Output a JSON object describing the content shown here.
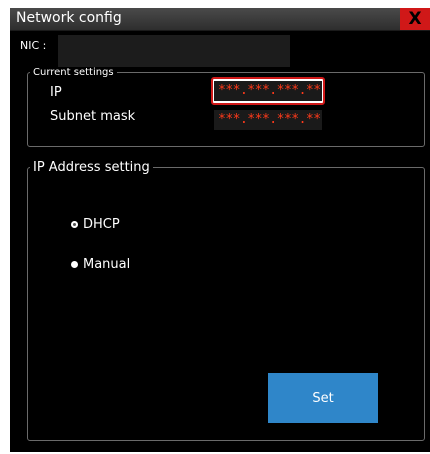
{
  "window": {
    "title": "Network config",
    "close_glyph": "X"
  },
  "nic": {
    "label": "NIC :",
    "value": ""
  },
  "current_settings": {
    "legend": "Current settings",
    "ip_label": "IP",
    "ip_value": "***.***.***.**",
    "subnet_label": "Subnet mask",
    "subnet_value": "***.***.***.**"
  },
  "ip_address_setting": {
    "legend": "IP Address setting",
    "options": [
      {
        "label": "DHCP",
        "selected": true
      },
      {
        "label": "Manual",
        "selected": false
      }
    ],
    "set_label": "Set"
  },
  "colors": {
    "background": "#000000",
    "masked_text": "#ff3a1a",
    "highlight": "#d01818",
    "button": "#2f86c9"
  }
}
